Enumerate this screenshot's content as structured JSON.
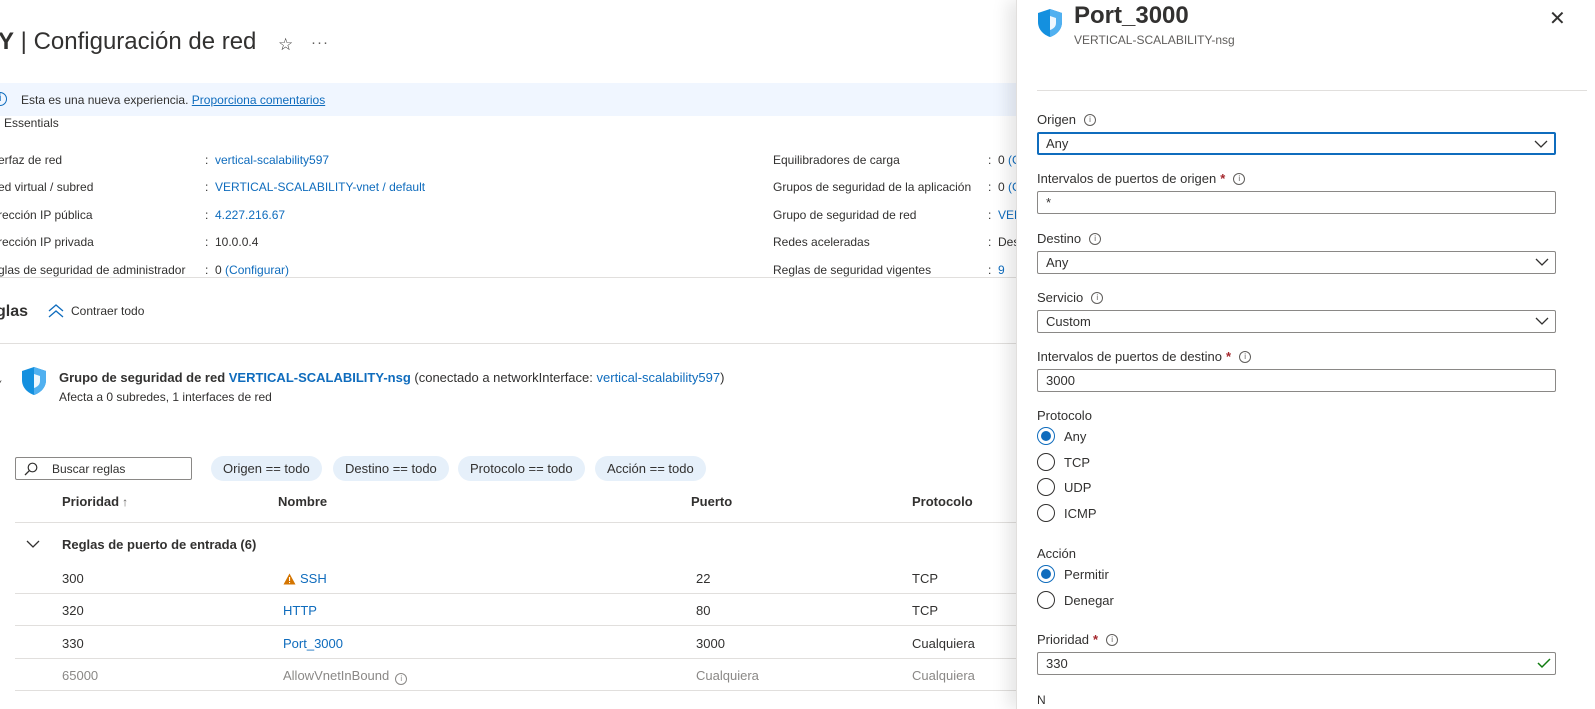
{
  "page": {
    "title_bold": "Y",
    "title_rest": " | Configuración de red",
    "star_glyph": "☆",
    "more_glyph": "···"
  },
  "banner": {
    "text": "Esta es una nueva experiencia.",
    "link": "Proporciona comentarios"
  },
  "essentials": {
    "title": "Essentials",
    "left": [
      {
        "key": "erfaz de red",
        "value": "vertical-scalability597",
        "link": true
      },
      {
        "key": "ed virtual / subred",
        "value": "VERTICAL-SCALABILITY-vnet / default",
        "link": true
      },
      {
        "key": "rección IP pública",
        "value": "4.227.216.67",
        "link": true
      },
      {
        "key": "rección IP privada",
        "value": "10.0.0.4",
        "link": false
      },
      {
        "key": "glas de seguridad de administrador",
        "value_plain": "0",
        "value_link": "(Configurar)"
      }
    ],
    "right": [
      {
        "key": "Equilibradores de carga",
        "value_plain": "0",
        "value_link": "(C"
      },
      {
        "key": "Grupos de seguridad de la aplicación",
        "value_plain": "0",
        "value_link": "(C"
      },
      {
        "key": "Grupo de seguridad de red",
        "value": "VER",
        "link": true
      },
      {
        "key": "Redes aceleradas",
        "value": "Des",
        "link": false
      },
      {
        "key": "Reglas de seguridad vigentes",
        "value": "9",
        "link": true
      }
    ]
  },
  "rules": {
    "title": "glas",
    "collapse_all": "Contraer todo"
  },
  "nsg": {
    "prefix": "Grupo de seguridad de red",
    "name": "VERTICAL-SCALABILITY-nsg",
    "connected_prefix": "(conectado a networkInterface:",
    "connected_link": "vertical-scalability597",
    "connected_suffix": ")",
    "affects": "Afecta a 0 subredes, 1 interfaces de red"
  },
  "filters": {
    "search_placeholder": "Buscar reglas",
    "pills": [
      "Origen == todo",
      "Destino == todo",
      "Protocolo == todo",
      "Acción == todo"
    ]
  },
  "table": {
    "headers": {
      "priority": "Prioridad",
      "sort_glyph": "↑",
      "name": "Nombre",
      "port": "Puerto",
      "protocol": "Protocolo"
    },
    "group_label": "Reglas de puerto de entrada (6)",
    "rows": [
      {
        "priority": "300",
        "name": "SSH",
        "port": "22",
        "protocol": "TCP",
        "warning": true
      },
      {
        "priority": "320",
        "name": "HTTP",
        "port": "80",
        "protocol": "TCP"
      },
      {
        "priority": "330",
        "name": "Port_3000",
        "port": "3000",
        "protocol": "Cualquiera"
      },
      {
        "priority": "65000",
        "name": "AllowVnetInBound",
        "port": "Cualquiera",
        "protocol": "Cualquiera",
        "default": true
      }
    ]
  },
  "panel": {
    "title": "Port_3000",
    "subtitle": "VERTICAL-SCALABILITY-nsg",
    "close_glyph": "✕",
    "source_label": "Origen",
    "source_value": "Any",
    "source_ports_label": "Intervalos de puertos de origen",
    "source_ports_value": "*",
    "destination_label": "Destino",
    "destination_value": "Any",
    "service_label": "Servicio",
    "service_value": "Custom",
    "dest_ports_label": "Intervalos de puertos de destino",
    "dest_ports_value": "3000",
    "protocol_label": "Protocolo",
    "protocol_options": [
      "Any",
      "TCP",
      "UDP",
      "ICMP"
    ],
    "protocol_selected": "Any",
    "action_label": "Acción",
    "action_options": [
      "Permitir",
      "Denegar"
    ],
    "action_selected": "Permitir",
    "priority_label": "Prioridad",
    "priority_value": "330",
    "required_mark": "*",
    "info_glyph": "i",
    "next_label_cut": "N"
  },
  "colors": {
    "accent": "#0f6cbd",
    "banner_bg": "#f0f6ff",
    "pill_bg": "#e6f0fa",
    "required": "#a4262c",
    "warning": "#d47500",
    "valid_check": "#107c10"
  }
}
